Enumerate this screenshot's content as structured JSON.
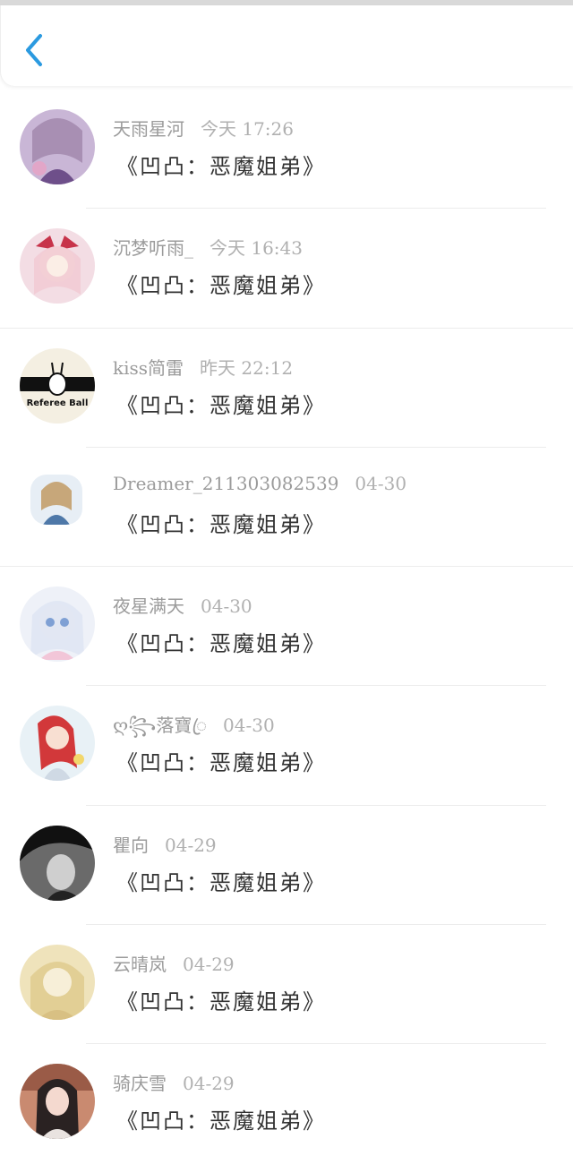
{
  "header": {
    "back_icon": "chevron-left-icon",
    "accent": "#2b9ae0"
  },
  "list": [
    {
      "name": "天雨星河",
      "time": "今天 17:26",
      "title": "《凹凸：恶魔姐弟》",
      "avatar": "anime-girl-avatar"
    },
    {
      "name": "沉梦听雨_",
      "time": "今天 16:43",
      "title": "《凹凸：恶魔姐弟》",
      "avatar": "anime-girl-avatar"
    },
    {
      "name": "kiss简雷",
      "time": "昨天 22:12",
      "title": "《凹凸：恶魔姐弟》",
      "avatar": "referee-ball-avatar",
      "avatar_text": "Referee Ball"
    },
    {
      "name": "Dreamer_211303082539",
      "time": "04-30",
      "title": "《凹凸：恶魔姐弟》",
      "avatar": "anime-girl-avatar"
    },
    {
      "name": "夜星满天",
      "time": "04-30",
      "title": "《凹凸：恶魔姐弟》",
      "avatar": "anime-girl-avatar"
    },
    {
      "name": "ღ꧂落寶ꦿ",
      "time": "04-30",
      "title": "《凹凸：恶魔姐弟》",
      "avatar": "anime-girl-avatar"
    },
    {
      "name": "瞿向",
      "time": "04-29",
      "title": "《凹凸：恶魔姐弟》",
      "avatar": "dark-portrait-avatar"
    },
    {
      "name": "云晴岚",
      "time": "04-29",
      "title": "《凹凸：恶魔姐弟》",
      "avatar": "sketch-girl-avatar"
    },
    {
      "name": "骑庆雪",
      "time": "04-29",
      "title": "《凹凸：恶魔姐弟》",
      "avatar": "photo-girl-avatar"
    }
  ]
}
